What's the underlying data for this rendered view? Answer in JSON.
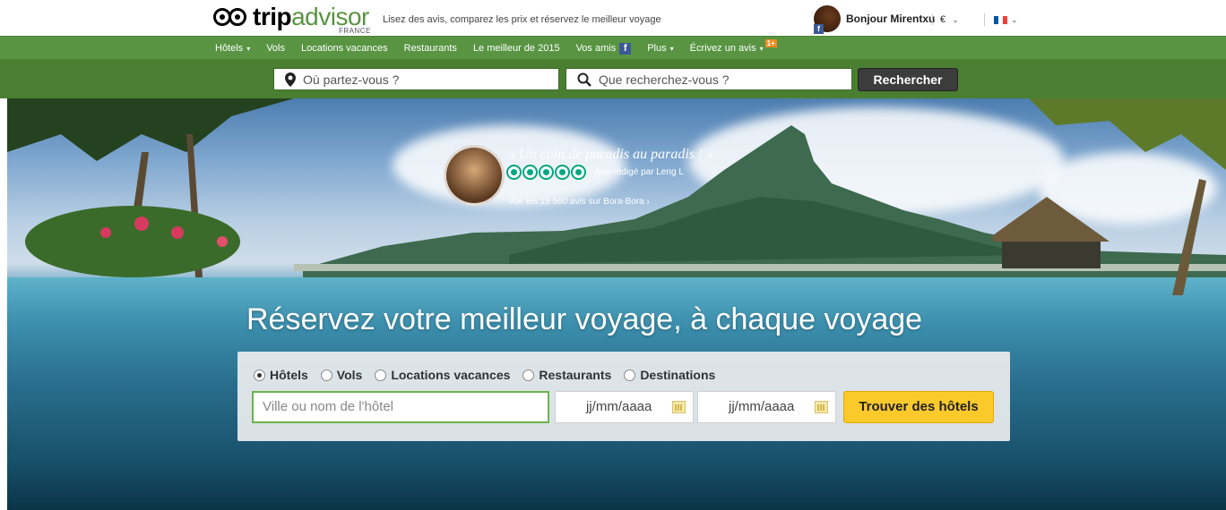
{
  "header": {
    "logo_trip": "trip",
    "logo_advisor": "advisor",
    "logo_country": "FRANCE",
    "tagline": "Lisez des avis, comparez les prix et réservez le meilleur voyage",
    "user_greeting": "Bonjour Mirentxu",
    "currency": "€",
    "flag_colors": [
      "#0055a4",
      "#ffffff",
      "#ef4135"
    ]
  },
  "nav": {
    "items": [
      {
        "label": "Hôtels",
        "dropdown": true
      },
      {
        "label": "Vols",
        "dropdown": false
      },
      {
        "label": "Locations vacances",
        "dropdown": false
      },
      {
        "label": "Restaurants",
        "dropdown": false
      },
      {
        "label": "Le meilleur de 2015",
        "dropdown": false
      },
      {
        "label": "Vos amis",
        "dropdown": false,
        "icon": "facebook-icon"
      },
      {
        "label": "Plus",
        "dropdown": true
      },
      {
        "label": "Écrivez un avis",
        "dropdown": true,
        "badge": "1+"
      }
    ]
  },
  "search": {
    "where_placeholder": "Où partez-vous ?",
    "what_placeholder": "Que recherchez-vous ?",
    "button": "Rechercher"
  },
  "hero": {
    "quote_title": "« Un coin de paradis au paradis ! »",
    "quote_author": "Avis rédigé par Leng L",
    "quote_link": "Voir les 15 560 avis sur Bora-Bora",
    "quote_link_arrow": "›",
    "rating_bubbles": 5,
    "headline": "Réservez votre meilleur voyage, à chaque voyage"
  },
  "booking": {
    "options": [
      {
        "label": "Hôtels",
        "selected": true
      },
      {
        "label": "Vols",
        "selected": false
      },
      {
        "label": "Locations vacances",
        "selected": false
      },
      {
        "label": "Restaurants",
        "selected": false
      },
      {
        "label": "Destinations",
        "selected": false
      }
    ],
    "city_placeholder": "Ville ou nom de l'hôtel",
    "checkin_placeholder": "jj/mm/aaaa",
    "checkout_placeholder": "jj/mm/aaaa",
    "submit": "Trouver des hôtels"
  },
  "colors": {
    "brand_green": "#589442",
    "search_green": "#4a7f32",
    "bubble_green": "#00a680",
    "cta_yellow": "#fcc92b"
  }
}
